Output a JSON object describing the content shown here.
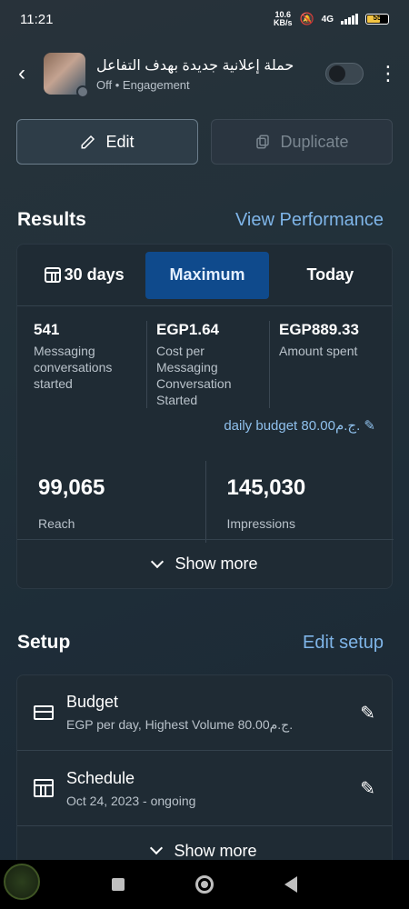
{
  "status_bar": {
    "time": "11:21",
    "net_speed_value": "10.6",
    "net_speed_unit": "KB/s",
    "network": "4G",
    "battery": "55"
  },
  "header": {
    "campaign_title": "حملة إعلانية جديدة بهدف التفاعل",
    "status": "Off",
    "separator": "•",
    "objective": "Engagement",
    "toggle_on": false
  },
  "actions": {
    "edit_label": "Edit",
    "duplicate_label": "Duplicate"
  },
  "results": {
    "title": "Results",
    "link": "View Performance",
    "tabs": [
      {
        "label": "30 days",
        "active": false
      },
      {
        "label": "Maximum",
        "active": true
      },
      {
        "label": "Today",
        "active": false
      }
    ],
    "metrics": [
      {
        "value": "541",
        "label": "Messaging conversations started"
      },
      {
        "value": "EGP1.64",
        "label": "Cost per Messaging Conversation Started"
      },
      {
        "value": "EGP889.33",
        "label": "Amount spent"
      }
    ],
    "daily_budget": "daily budget 80.00ج.م.",
    "reach": {
      "value": "99,065",
      "label": "Reach"
    },
    "impressions": {
      "value": "145,030",
      "label": "Impressions"
    },
    "show_more": "Show more"
  },
  "setup": {
    "title": "Setup",
    "link": "Edit setup",
    "items": [
      {
        "title": "Budget",
        "subtitle": "EGP per day, Highest Volume 80.00ج.م."
      },
      {
        "title": "Schedule",
        "subtitle": "Oct 24, 2023 - ongoing"
      }
    ],
    "show_more": "Show more"
  },
  "colors": {
    "accent_link": "#7fb5e8",
    "active_tab": "#0f4a8c"
  }
}
